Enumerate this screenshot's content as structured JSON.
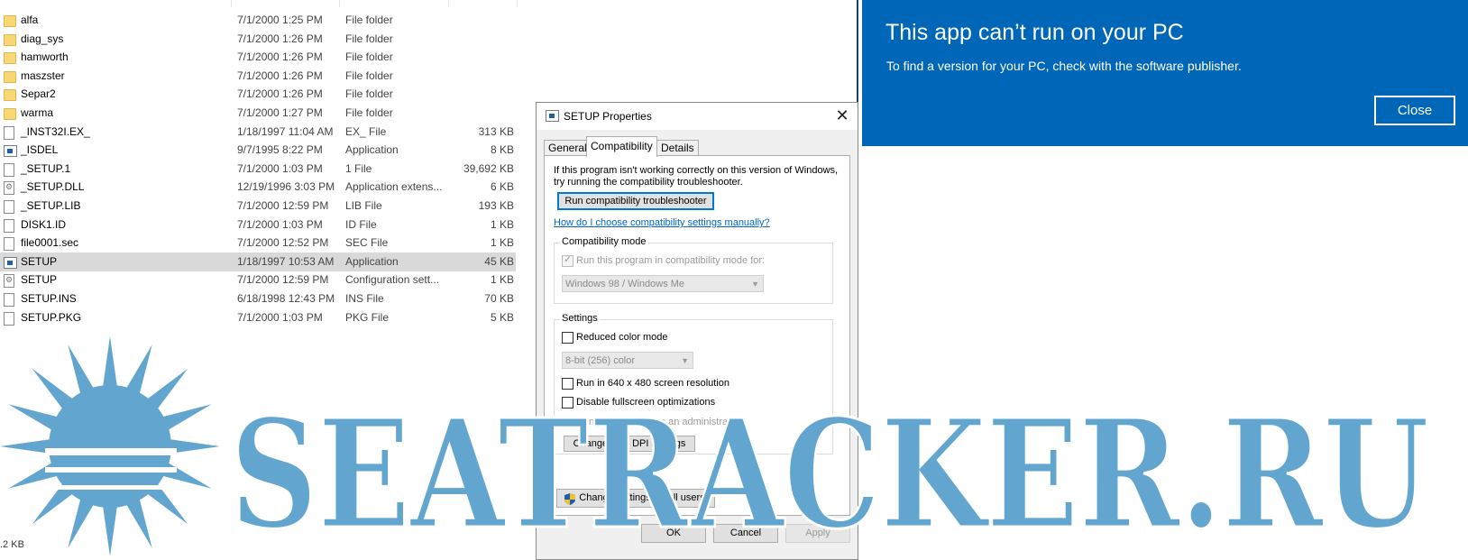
{
  "explorer": {
    "rows": [
      {
        "name": "alfa",
        "date": "7/1/2000 1:25 PM",
        "type": "File folder",
        "size": "",
        "icon": "folder-icon"
      },
      {
        "name": "diag_sys",
        "date": "7/1/2000 1:26 PM",
        "type": "File folder",
        "size": "",
        "icon": "folder-icon"
      },
      {
        "name": "hamworth",
        "date": "7/1/2000 1:26 PM",
        "type": "File folder",
        "size": "",
        "icon": "folder-icon"
      },
      {
        "name": "maszster",
        "date": "7/1/2000 1:26 PM",
        "type": "File folder",
        "size": "",
        "icon": "folder-icon"
      },
      {
        "name": "Separ2",
        "date": "7/1/2000 1:26 PM",
        "type": "File folder",
        "size": "",
        "icon": "folder-icon"
      },
      {
        "name": "warma",
        "date": "7/1/2000 1:27 PM",
        "type": "File folder",
        "size": "",
        "icon": "folder-icon"
      },
      {
        "name": "_INST32I.EX_",
        "date": "1/18/1997 11:04 AM",
        "type": "EX_ File",
        "size": "313 KB",
        "icon": "file-icon"
      },
      {
        "name": "_ISDEL",
        "date": "9/7/1995 8:22 PM",
        "type": "Application",
        "size": "8 KB",
        "icon": "app-icon"
      },
      {
        "name": "_SETUP.1",
        "date": "7/1/2000 1:03 PM",
        "type": "1 File",
        "size": "39,692 KB",
        "icon": "file-icon"
      },
      {
        "name": "_SETUP.DLL",
        "date": "12/19/1996 3:03 PM",
        "type": "Application extens...",
        "size": "6 KB",
        "icon": "gear-file-icon"
      },
      {
        "name": "_SETUP.LIB",
        "date": "7/1/2000 12:59 PM",
        "type": "LIB File",
        "size": "193 KB",
        "icon": "file-icon"
      },
      {
        "name": "DISK1.ID",
        "date": "7/1/2000 1:03 PM",
        "type": "ID File",
        "size": "1 KB",
        "icon": "file-icon"
      },
      {
        "name": "file0001.sec",
        "date": "7/1/2000 12:52 PM",
        "type": "SEC File",
        "size": "1 KB",
        "icon": "file-icon"
      },
      {
        "name": "SETUP",
        "date": "1/18/1997 10:53 AM",
        "type": "Application",
        "size": "45 KB",
        "icon": "app-icon",
        "selected": true
      },
      {
        "name": "SETUP",
        "date": "7/1/2000 12:59 PM",
        "type": "Configuration sett...",
        "size": "1 KB",
        "icon": "gear-file-icon"
      },
      {
        "name": "SETUP.INS",
        "date": "6/18/1998 12:43 PM",
        "type": "INS File",
        "size": "70 KB",
        "icon": "file-icon"
      },
      {
        "name": "SETUP.PKG",
        "date": "7/1/2000 1:03 PM",
        "type": "PKG File",
        "size": "5 KB",
        "icon": "file-icon"
      }
    ],
    "status": ".2 KB"
  },
  "banner": {
    "title": "This app can’t run on your PC",
    "message": "To find a version for your PC, check with the software publisher.",
    "close_label": "Close",
    "color": "#0067b8"
  },
  "dialog": {
    "title": "SETUP Properties",
    "tabs": [
      {
        "label": "General"
      },
      {
        "label": "Compatibility",
        "active": true
      },
      {
        "label": "Details"
      }
    ],
    "info_text": "If this program isn't working correctly on this version of Windows, try running the compatibility troubleshooter.",
    "troubleshooter_label": "Run compatibility troubleshooter",
    "help_link": "How do I choose compatibility settings manually?",
    "compat_group": {
      "title": "Compatibility mode",
      "checkbox_label": "Run this program in compatibility mode for:",
      "checkbox_checked": true,
      "os_selected": "Windows 98 / Windows Me"
    },
    "settings_group": {
      "title": "Settings",
      "reduced_color_label": "Reduced color mode",
      "color_selected": "8-bit (256) color",
      "resolution_label": "Run in 640 x 480 screen resolution",
      "fullscreen_label": "Disable fullscreen optimizations",
      "admin_label": "Run this program as an administrator",
      "admin_checked": true,
      "dpi_label": "Change high DPI settings"
    },
    "all_users_label": "Change settings for all users",
    "ok_label": "OK",
    "cancel_label": "Cancel",
    "apply_label": "Apply"
  },
  "watermark": {
    "text": "SEATRACKER.RU",
    "color": "#62a6cf"
  }
}
